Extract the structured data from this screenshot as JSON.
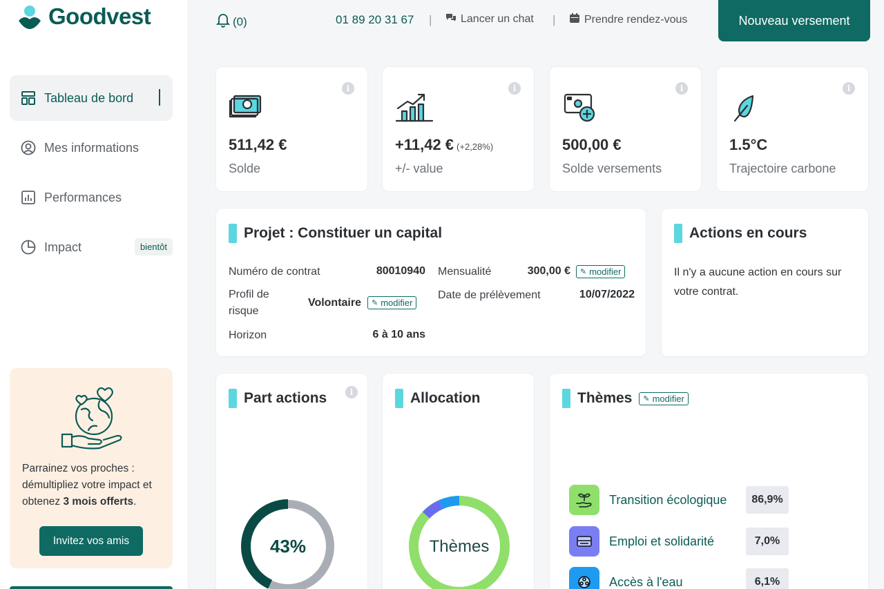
{
  "brand": {
    "name": "Goodvest"
  },
  "sidebar": {
    "items": [
      {
        "label": "Tableau de bord",
        "icon": "dashboard-icon",
        "active": true
      },
      {
        "label": "Mes informations",
        "icon": "user-circle-icon"
      },
      {
        "label": "Performances",
        "icon": "bar-chart-icon"
      },
      {
        "label": "Impact",
        "icon": "pie-chart-icon",
        "badge": "bientôt"
      }
    ],
    "promo": {
      "text_before": "Parrainez vos proches : démultipliez votre impact et obtenez ",
      "text_bold": "3 mois offerts",
      "text_after": ".",
      "button": "Invitez vos amis"
    }
  },
  "topbar": {
    "notifications": "(0)",
    "phone": "01 89 20 31 67",
    "chat": "Lancer un chat",
    "appointment": "Prendre rendez-vous",
    "cta": "Nouveau versement"
  },
  "kpis": [
    {
      "value": "511,42 €",
      "extra": "",
      "label": "Solde",
      "icon": "money-icon"
    },
    {
      "value": "+11,42 €",
      "extra": "(+2,28%)",
      "label": "+/- value",
      "icon": "growth-chart-icon"
    },
    {
      "value": "500,00 €",
      "extra": "",
      "label": "Solde versements",
      "icon": "deposit-plus-icon"
    },
    {
      "value": "1.5°C",
      "extra": "",
      "label": "Trajectoire carbone",
      "icon": "leaf-icon"
    }
  ],
  "project": {
    "title": "Projet : Constituer un capital",
    "contract_label": "Numéro de contrat",
    "contract_value": "80010940",
    "risk_label": "Profil de risque",
    "risk_value": "Volontaire",
    "horizon_label": "Horizon",
    "horizon_value": "6 à 10 ans",
    "monthly_label": "Mensualité",
    "monthly_value": "300,00 €",
    "debit_label": "Date de prélèvement",
    "debit_value": "10/07/2022",
    "edit_label": "modifier"
  },
  "actions": {
    "title": "Actions en cours",
    "text": "Il n'y a aucune action en cours sur votre contrat."
  },
  "part_actions": {
    "title": "Part actions",
    "value": "43%",
    "fraction": 0.43
  },
  "allocation": {
    "title": "Allocation",
    "center": "Thèmes"
  },
  "themes": {
    "title": "Thèmes",
    "edit_label": "modifier",
    "items": [
      {
        "name": "Transition écologique",
        "pct": "86,9%",
        "icon": "plant-hand-icon",
        "color": "#8fdf6a"
      },
      {
        "name": "Emploi et solidarité",
        "pct": "7,0%",
        "icon": "solidarity-icon",
        "color": "#6a6cf0"
      },
      {
        "name": "Accès à l'eau",
        "pct": "6,1%",
        "icon": "water-icon",
        "color": "#1e9bf0"
      }
    ]
  },
  "colors": {
    "brand": "#0e6a62",
    "accent": "#5cd6df"
  }
}
